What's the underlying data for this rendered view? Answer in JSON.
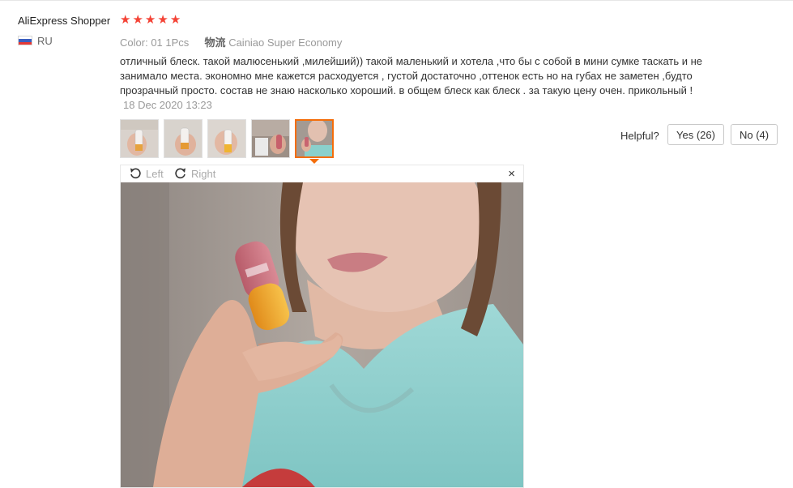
{
  "review": {
    "user": "AliExpress Shopper",
    "rating": 5,
    "country": "RU",
    "color_label": "Color:",
    "color_value": "01 1Pcs",
    "shipping_label": "物流",
    "shipping_value": "Cainiao Super Economy",
    "text": "отличный блеск. такой малюсенький ,милейший)) такой маленький и хотела ,что бы с собой в мини сумке таскать и не занимало места. экономно мне кажется расходуется , густой достаточно ,оттенок есть но на губах не заметен ,будто прозрачный просто. состав не знаю насколько хороший. в общем блеск как блеск . за такую цену очен. прикольный !",
    "date": "18 Dec 2020 13:23"
  },
  "thumbnails": [
    {
      "name": "photo-1",
      "active": false
    },
    {
      "name": "photo-2",
      "active": false
    },
    {
      "name": "photo-3",
      "active": false
    },
    {
      "name": "photo-4",
      "active": false
    },
    {
      "name": "photo-5",
      "active": true
    }
  ],
  "helpful": {
    "label": "Helpful?",
    "yes_label": "Yes (26)",
    "no_label": "No (4)"
  },
  "viewer": {
    "rotate_left_label": "Left",
    "rotate_right_label": "Right",
    "close_label": "×"
  },
  "colors": {
    "star": "#f44336",
    "accent": "#f46d0a",
    "muted": "#999999"
  },
  "icons": [
    "star-icon",
    "ru-flag-icon",
    "rotate-left-icon",
    "rotate-right-icon",
    "close-icon"
  ]
}
